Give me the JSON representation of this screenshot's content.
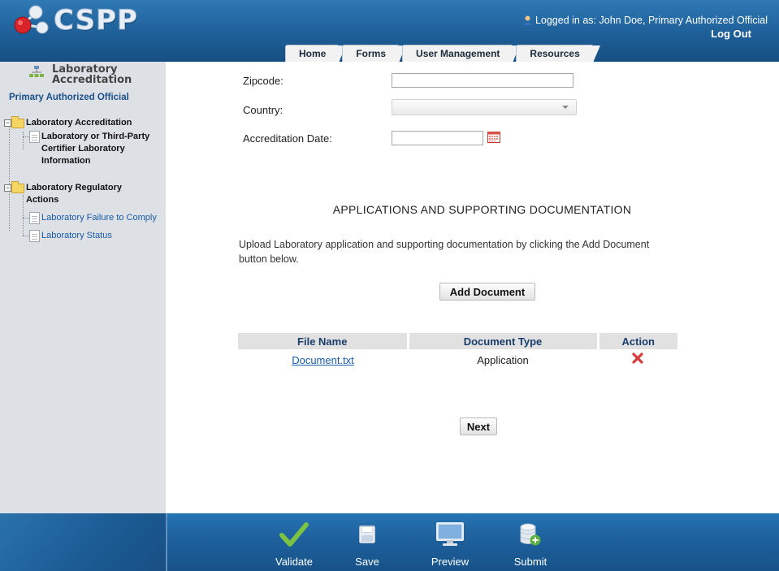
{
  "header": {
    "logo_text": "CSPP",
    "logged_in_text": "Logged in as: John Doe, Primary Authorized Official",
    "logout_label": "Log Out"
  },
  "tabs": [
    {
      "label": "Home"
    },
    {
      "label": "Forms"
    },
    {
      "label": "User Management"
    },
    {
      "label": "Resources"
    }
  ],
  "sidebar": {
    "title_line1": "Laboratory",
    "title_line2": "Accreditation",
    "role": "Primary Authorized Official",
    "tree": [
      {
        "label": "Laboratory Accreditation",
        "children": [
          {
            "label_lines": [
              "Laboratory or Third-Party",
              "Certifier Laboratory",
              "Information"
            ]
          }
        ]
      },
      {
        "label_lines": [
          "Laboratory Regulatory",
          "Actions"
        ],
        "children": [
          {
            "label": "Laboratory Failure to Comply"
          },
          {
            "label": "Laboratory Status"
          }
        ]
      }
    ]
  },
  "form": {
    "zipcode_label": "Zipcode:",
    "zipcode_value": "",
    "country_label": "Country:",
    "country_value": "",
    "accreditation_date_label": "Accreditation Date:",
    "accreditation_date_value": ""
  },
  "documents": {
    "section_title": "APPLICATIONS AND SUPPORTING DOCUMENTATION",
    "instructions": "Upload Laboratory application and supporting documentation by clicking the Add Document button below.",
    "add_button": "Add Document",
    "columns": [
      "File Name",
      "Document Type",
      "Action"
    ],
    "rows": [
      {
        "file_name": "Document.txt",
        "document_type": "Application"
      }
    ],
    "next_button": "Next"
  },
  "footer": {
    "actions": [
      {
        "label": "Validate",
        "icon": "checkmark-icon"
      },
      {
        "label": "Save",
        "icon": "floppy-disk-icon"
      },
      {
        "label": "Preview",
        "icon": "monitor-icon"
      },
      {
        "label": "Submit",
        "icon": "database-add-icon"
      }
    ]
  },
  "colors": {
    "header_blue": "#1e5f98",
    "sidebar_bg": "#dde1e6",
    "link_blue": "#1a5aa8",
    "delete_red": "#d63a3a",
    "validate_green": "#7cc242"
  }
}
